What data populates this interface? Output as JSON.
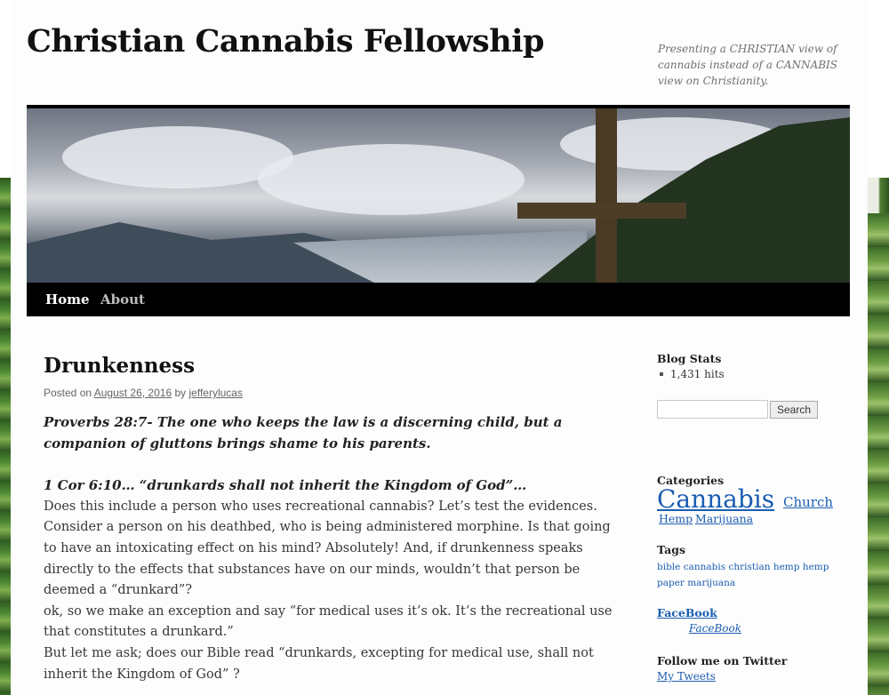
{
  "site": {
    "title": "Christian Cannabis Fellowship",
    "description": "Presenting a CHRISTIAN view of cannabis instead of a CANNABIS view on Christianity."
  },
  "nav": {
    "items": [
      "Home",
      "About"
    ]
  },
  "post": {
    "title": "Drunkenness",
    "posted_on": "Posted on",
    "date": "August 26, 2016",
    "by": "by",
    "author": "jefferylucas",
    "verse1": "Proverbs 28:7- The one who keeps the law is a discerning child, but a companion of gluttons brings shame to his parents.",
    "verse2": "1 Cor 6:10… “drunkards shall not inherit the Kingdom of God”…",
    "para1": "Does this include a person who uses recreational cannabis? Let’s test the evidences. Consider a person on his deathbed, who is being administered morphine. Is that going to have an intoxicating effect on his mind? Absolutely! And, if drunkenness speaks directly to the effects that substances have on our minds, wouldn’t that person be deemed a “drunkard”?",
    "para2": "ok, so we make an exception and say “for medical uses it’s ok. It’s the recreational use that constitutes a drunkard.”",
    "para3": "But let me ask; does our Bible read “drunkards, excepting for medical use, shall not inherit the Kingdom of God” ?"
  },
  "sidebar": {
    "blog_stats": {
      "title": "Blog Stats",
      "hits": "1,431 hits"
    },
    "search": {
      "placeholder": "",
      "button": "Search"
    },
    "categories": {
      "title": "Categories",
      "items": [
        "Cannabis",
        "Church",
        "Hemp",
        "Marijuana"
      ]
    },
    "tags": {
      "title": "Tags",
      "items": [
        "bible",
        "cannabis",
        "christian",
        "hemp",
        "hemp paper",
        "marijuana"
      ]
    },
    "facebook": {
      "title": "FaceBook",
      "link": "FaceBook"
    },
    "twitter": {
      "title": "Follow me on Twitter",
      "link": "My Tweets"
    }
  },
  "colors": {
    "link": "#1b5eb1",
    "nav_bg": "#000000",
    "text": "#373737"
  }
}
